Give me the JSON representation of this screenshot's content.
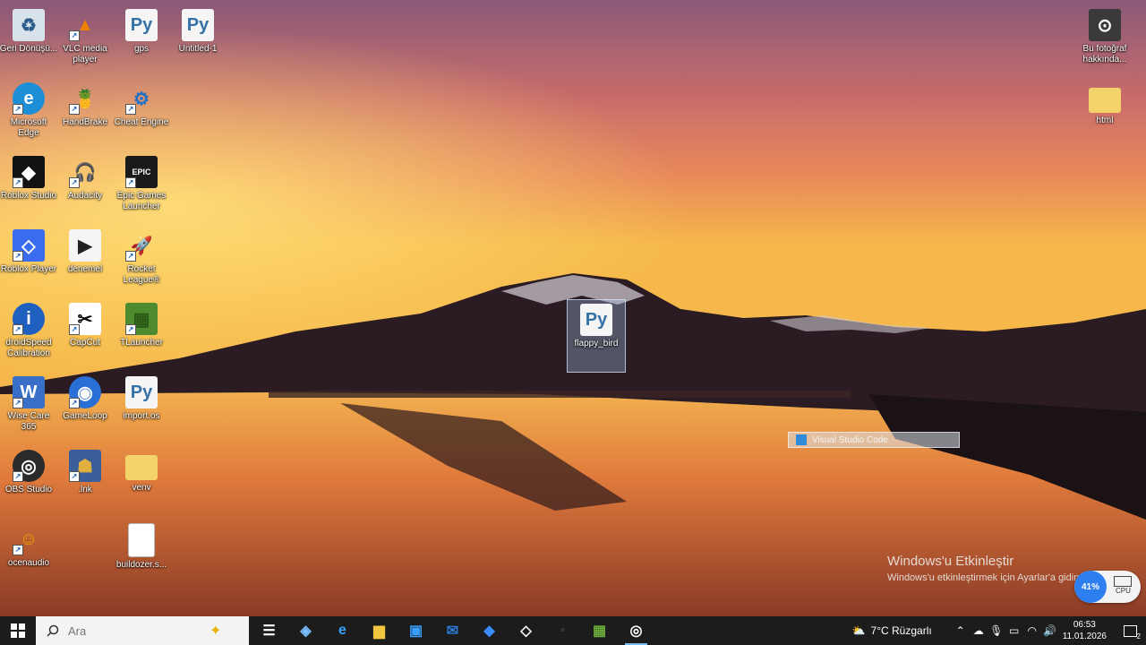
{
  "desktop": {
    "icons": [
      {
        "label": "Geri Dönüşü...",
        "icon": "recycle-bin-icon"
      },
      {
        "label": "VLC media player",
        "icon": "vlc-icon"
      },
      {
        "label": "gps",
        "icon": "python-file-icon"
      },
      {
        "label": "Untitled-1",
        "icon": "python-file-icon"
      },
      {
        "label": "Microsoft Edge",
        "icon": "edge-icon"
      },
      {
        "label": "HandBrake",
        "icon": "handbrake-icon"
      },
      {
        "label": "Cheat Engine",
        "icon": "cheat-engine-icon"
      },
      {
        "label": "Roblox Studio",
        "icon": "roblox-studio-icon"
      },
      {
        "label": "Audacity",
        "icon": "audacity-icon"
      },
      {
        "label": "Epic Games Launcher",
        "icon": "epic-games-icon"
      },
      {
        "label": "Roblox Player",
        "icon": "roblox-player-icon"
      },
      {
        "label": "denemel",
        "icon": "video-file-icon"
      },
      {
        "label": "Rocket League®",
        "icon": "rocket-league-icon"
      },
      {
        "label": "droidSpeed Calibration",
        "icon": "info-icon"
      },
      {
        "label": "CapCut",
        "icon": "capcut-icon"
      },
      {
        "label": "TLauncher",
        "icon": "tlauncher-icon"
      },
      {
        "label": "Wise Care 365",
        "icon": "wise-care-icon"
      },
      {
        "label": "GameLoop",
        "icon": "gameloop-icon"
      },
      {
        "label": "import.os",
        "icon": "python-file-icon"
      },
      {
        "label": "OBS Studio",
        "icon": "obs-icon"
      },
      {
        "label": ".lnk",
        "icon": "game-shortcut-icon"
      },
      {
        "label": "venv",
        "icon": "folder-icon"
      },
      {
        "label": "ocenaudio",
        "icon": "ocenaudio-icon"
      },
      {
        "label": "buildozer.s...",
        "icon": "text-file-icon"
      },
      {
        "label": "flappy_bird",
        "icon": "python-file-icon"
      },
      {
        "label": "Bu fotoğraf hakkında...",
        "icon": "camera-icon"
      },
      {
        "label": "html",
        "icon": "folder-icon"
      }
    ],
    "drag_ghost": "Visual Studio Code",
    "activation": {
      "title": "Windows'u Etkinleştir",
      "subtitle": "Windows'u etkinleştirmek için Ayarlar'a gidin."
    },
    "cpu_widget": {
      "value": "41%",
      "label": "CPU"
    }
  },
  "taskbar": {
    "search_placeholder": "Ara",
    "apps": [
      {
        "icon": "task-view-icon"
      },
      {
        "icon": "copilot-icon"
      },
      {
        "icon": "edge-icon"
      },
      {
        "icon": "file-explorer-icon"
      },
      {
        "icon": "store-icon"
      },
      {
        "icon": "outlook-icon"
      },
      {
        "icon": "roblox-studio-icon"
      },
      {
        "icon": "roblox-player-icon"
      },
      {
        "icon": "terminal-icon"
      },
      {
        "icon": "tlauncher-icon"
      },
      {
        "icon": "obs-icon"
      }
    ],
    "weather": "7°C Rüzgarlı",
    "clock": {
      "time": "06:53",
      "date": "11.01.2026"
    },
    "notification_count": "2"
  }
}
